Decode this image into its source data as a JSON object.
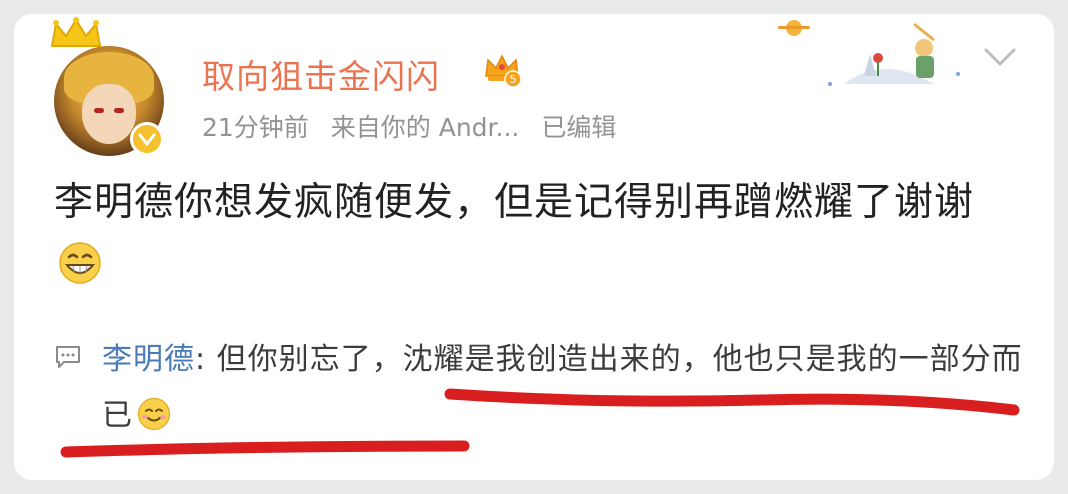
{
  "post": {
    "username": "取向狙击金闪闪",
    "vip_level": "5",
    "time": "21分钟前",
    "source_prefix": "来自",
    "source": "你的 Andr...",
    "edited": "已编辑",
    "content": "李明德你想发疯随便发，但是记得别再蹭燃耀了谢谢",
    "emoji": "grinning-face"
  },
  "comment": {
    "author": "李明德",
    "separator": ": ",
    "text": "但你别忘了，沈耀是我创造出来的，他也只是我的一部分而已",
    "emoji": "smiling-face"
  },
  "colors": {
    "username": "#eb7350",
    "comment_author": "#4a7bb7",
    "meta": "#939393",
    "annotation": "#d81e1e",
    "badge": "#f6c12e"
  },
  "icons": [
    "crown-icon",
    "verified-badge-icon",
    "vip-crown-icon",
    "chevron-down-icon",
    "comment-icon",
    "grinning-emoji",
    "smiling-emoji"
  ]
}
